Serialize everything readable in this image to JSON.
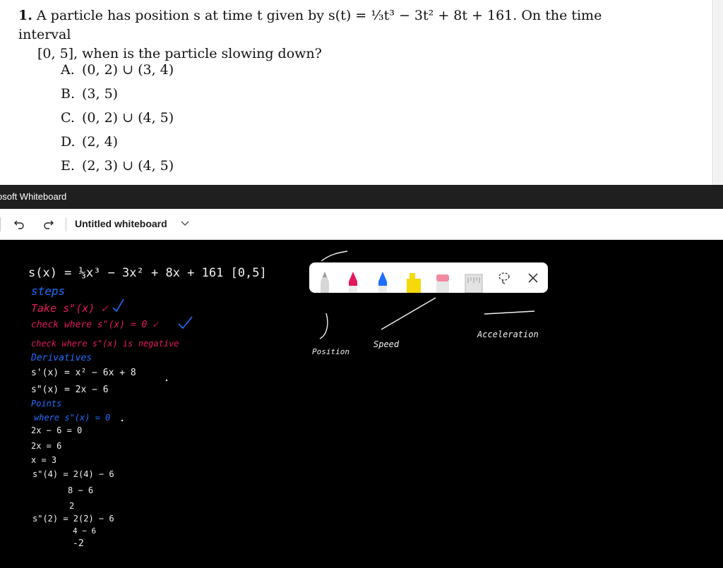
{
  "question": {
    "number": "1.",
    "stem_line1": "A particle has position s at time t given by s(t) = ⅓t³ − 3t² + 8t + 161. On the time interval",
    "stem_line2": "[0, 5], when is the particle slowing down?",
    "choices": [
      {
        "letter": "A.",
        "text": "(0, 2) ∪ (3, 4)"
      },
      {
        "letter": "B.",
        "text": "(3, 5)"
      },
      {
        "letter": "C.",
        "text": "(0, 2) ∪ (4, 5)"
      },
      {
        "letter": "D.",
        "text": "(2, 4)"
      },
      {
        "letter": "E.",
        "text": "(2, 3) ∪ (4, 5)"
      }
    ]
  },
  "app": {
    "title": "osoft Whiteboard",
    "board_name": "Untitled whiteboard",
    "icons": [
      "undo-icon",
      "redo-icon",
      "chevron-down-icon"
    ]
  },
  "ink": {
    "lines": [
      {
        "text": "s(x) = ⅓x³ − 3x² + 8x + 161   [0,5]",
        "color": "white"
      },
      {
        "text": "steps",
        "color": "blue"
      },
      {
        "text": "Take  s\"(x) ✓",
        "color": "pink"
      },
      {
        "text": "check where  s\"(x) = 0 ✓",
        "color": "pink"
      },
      {
        "text": "check where  s\"(x) is negative",
        "color": "pink"
      },
      {
        "text": "Derivatives",
        "color": "blue"
      },
      {
        "text": "s'(x) = x² − 6x + 8",
        "color": "white"
      },
      {
        "text": "s\"(x) = 2x − 6",
        "color": "white"
      },
      {
        "text": "Points",
        "color": "blue"
      },
      {
        "text": "where  s\"(x) = 0",
        "color": "blue"
      },
      {
        "text": "2x − 6 = 0",
        "color": "white"
      },
      {
        "text": "2x = 6",
        "color": "white"
      },
      {
        "text": "x = 3",
        "color": "white"
      },
      {
        "text": "s\"(4) = 2(4) − 6",
        "color": "white"
      },
      {
        "text": "8 − 6",
        "color": "white"
      },
      {
        "text": "2",
        "color": "white"
      },
      {
        "text": "s\"(2) = 2(2) − 6",
        "color": "white"
      },
      {
        "text": "4 − 6",
        "color": "white"
      },
      {
        "text": "-2",
        "color": "white"
      }
    ],
    "sketch_labels": [
      "Position",
      "Speed",
      "Acceleration"
    ]
  },
  "pen_tray": {
    "tools": [
      {
        "name": "white-pen",
        "color": "#d0d0d0"
      },
      {
        "name": "pink-pen",
        "color": "#e3185b"
      },
      {
        "name": "blue-pen",
        "color": "#1f6fff"
      },
      {
        "name": "highlighter",
        "color": "#f5d90a"
      },
      {
        "name": "eraser",
        "color": "#f08aa0"
      },
      {
        "name": "ruler",
        "color": "#dcdcdc"
      }
    ],
    "icons": [
      "lasso-select-icon",
      "close-icon"
    ]
  }
}
